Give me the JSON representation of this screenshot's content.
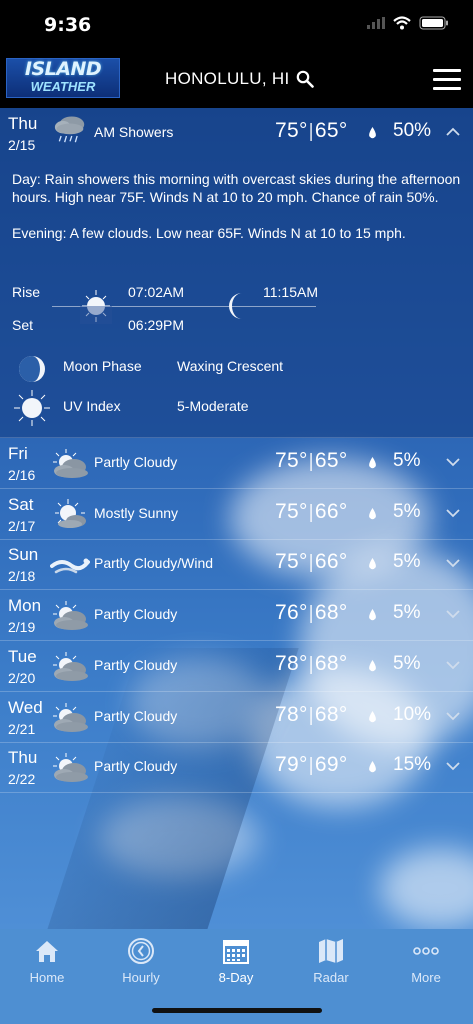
{
  "status_bar": {
    "time": "9:36"
  },
  "header": {
    "logo_line1": "ISLAND",
    "logo_line2": "WEATHER",
    "location": "HONOLULU, HI"
  },
  "expanded_day": {
    "day": "Thu",
    "date": "2/15",
    "condition": "AM Showers",
    "icon": "cloud-rain-icon",
    "high": "75°",
    "low": "65°",
    "precip": "50%",
    "day_label": "Day",
    "day_text": ": Rain showers this morning with overcast skies during the afternoon hours. High near 75F. Winds N at 10 to 20 mph. Chance of rain 50%.",
    "evening_label": "Evening",
    "evening_text": ": A few clouds. Low near 65F. Winds N at 10 to 15 mph.",
    "rise_label": "Rise",
    "set_label": "Set",
    "sunrise": "07:02AM",
    "sunset": "06:29PM",
    "moonrise": "11:15AM",
    "moon_phase_label": "Moon Phase",
    "moon_phase_value": "Waxing Crescent",
    "uv_label": "UV Index",
    "uv_value": "5-Moderate"
  },
  "days": [
    {
      "day": "Fri",
      "date": "2/16",
      "icon": "partly-cloudy-icon",
      "condition": "Partly Cloudy",
      "high": "75°",
      "low": "65°",
      "precip": "5%"
    },
    {
      "day": "Sat",
      "date": "2/17",
      "icon": "mostly-sunny-icon",
      "condition": "Mostly Sunny",
      "high": "75°",
      "low": "66°",
      "precip": "5%"
    },
    {
      "day": "Sun",
      "date": "2/18",
      "icon": "wind-icon",
      "condition": "Partly Cloudy/Wind",
      "high": "75°",
      "low": "66°",
      "precip": "5%"
    },
    {
      "day": "Mon",
      "date": "2/19",
      "icon": "partly-cloudy-icon",
      "condition": "Partly Cloudy",
      "high": "76°",
      "low": "68°",
      "precip": "5%"
    },
    {
      "day": "Tue",
      "date": "2/20",
      "icon": "partly-cloudy-icon",
      "condition": "Partly Cloudy",
      "high": "78°",
      "low": "68°",
      "precip": "5%"
    },
    {
      "day": "Wed",
      "date": "2/21",
      "icon": "partly-cloudy-icon",
      "condition": "Partly Cloudy",
      "high": "78°",
      "low": "68°",
      "precip": "10%"
    },
    {
      "day": "Thu",
      "date": "2/22",
      "icon": "partly-cloudy-icon",
      "condition": "Partly Cloudy",
      "high": "79°",
      "low": "69°",
      "precip": "15%"
    }
  ],
  "tabs": [
    {
      "label": "Home",
      "icon": "home-icon"
    },
    {
      "label": "Hourly",
      "icon": "clock-icon"
    },
    {
      "label": "8-Day",
      "icon": "calendar-icon",
      "active": true
    },
    {
      "label": "Radar",
      "icon": "map-icon"
    },
    {
      "label": "More",
      "icon": "more-icon"
    }
  ],
  "colors": {
    "accent": "#4e8fd2",
    "header_bg": "#000000",
    "content_top": "#1c4f9a"
  }
}
